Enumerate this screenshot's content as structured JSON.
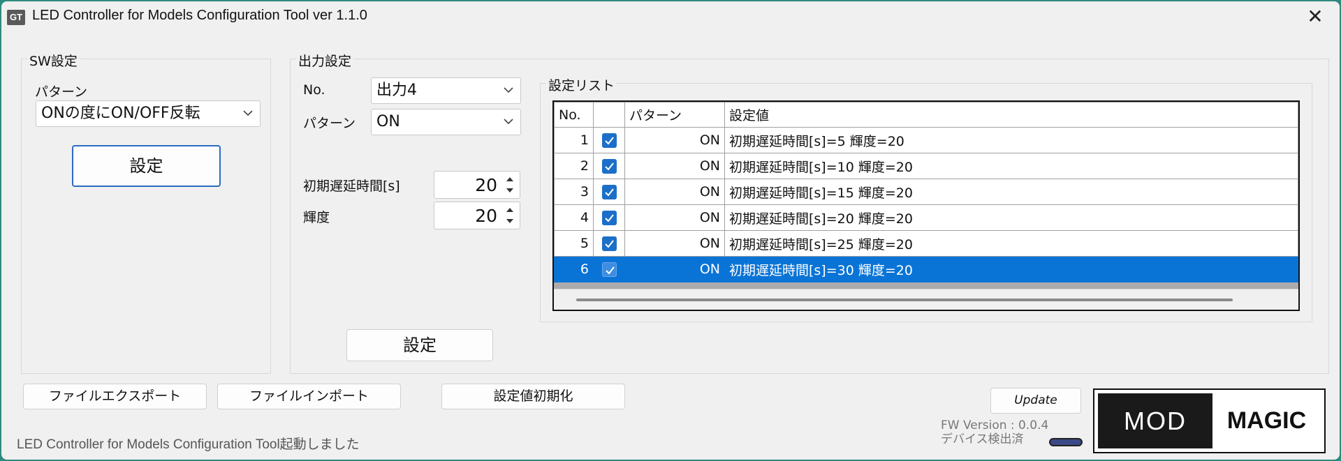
{
  "window": {
    "title": "LED Controller for Models Configuration Tool ver 1.1.0",
    "icon_text": "GT",
    "close_glyph": "✕"
  },
  "sw_group": {
    "title": "SW設定",
    "pattern_label": "パターン",
    "pattern_value": "ONの度にON/OFF反転",
    "set_button": "設定"
  },
  "output_group": {
    "title": "出力設定",
    "no_label": "No.",
    "no_value": "出力4",
    "pattern_label": "パターン",
    "pattern_value": "ON",
    "delay_label": "初期遅延時間[s]",
    "delay_value": "20",
    "brightness_label": "輝度",
    "brightness_value": "20",
    "set_button": "設定"
  },
  "settings_list": {
    "title": "設定リスト",
    "columns": [
      "No.",
      "",
      "パターン",
      "設定値"
    ],
    "rows": [
      {
        "no": "1",
        "checked": true,
        "pattern": "ON",
        "value": "初期遅延時間[s]=5 輝度=20",
        "selected": false
      },
      {
        "no": "2",
        "checked": true,
        "pattern": "ON",
        "value": "初期遅延時間[s]=10 輝度=20",
        "selected": false
      },
      {
        "no": "3",
        "checked": true,
        "pattern": "ON",
        "value": "初期遅延時間[s]=15 輝度=20",
        "selected": false
      },
      {
        "no": "4",
        "checked": true,
        "pattern": "ON",
        "value": "初期遅延時間[s]=20 輝度=20",
        "selected": false
      },
      {
        "no": "5",
        "checked": true,
        "pattern": "ON",
        "value": "初期遅延時間[s]=25 輝度=20",
        "selected": false
      },
      {
        "no": "6",
        "checked": true,
        "pattern": "ON",
        "value": "初期遅延時間[s]=30 輝度=20",
        "selected": true
      }
    ]
  },
  "bottom_buttons": {
    "export": "ファイルエクスポート",
    "import": "ファイルインポート",
    "reset": "設定値初期化",
    "update": "Update"
  },
  "status": {
    "message": "LED Controller for Models Configuration Tool起動しました",
    "fw_version": "FW Version : 0.0.4",
    "device_status": "デバイス検出済"
  },
  "logo": {
    "left": "MOD",
    "right": "MAGIC"
  },
  "colors": {
    "accent": "#0a74d6",
    "checkbox": "#1c6fc8",
    "led_indicator": "#3b4a86"
  }
}
